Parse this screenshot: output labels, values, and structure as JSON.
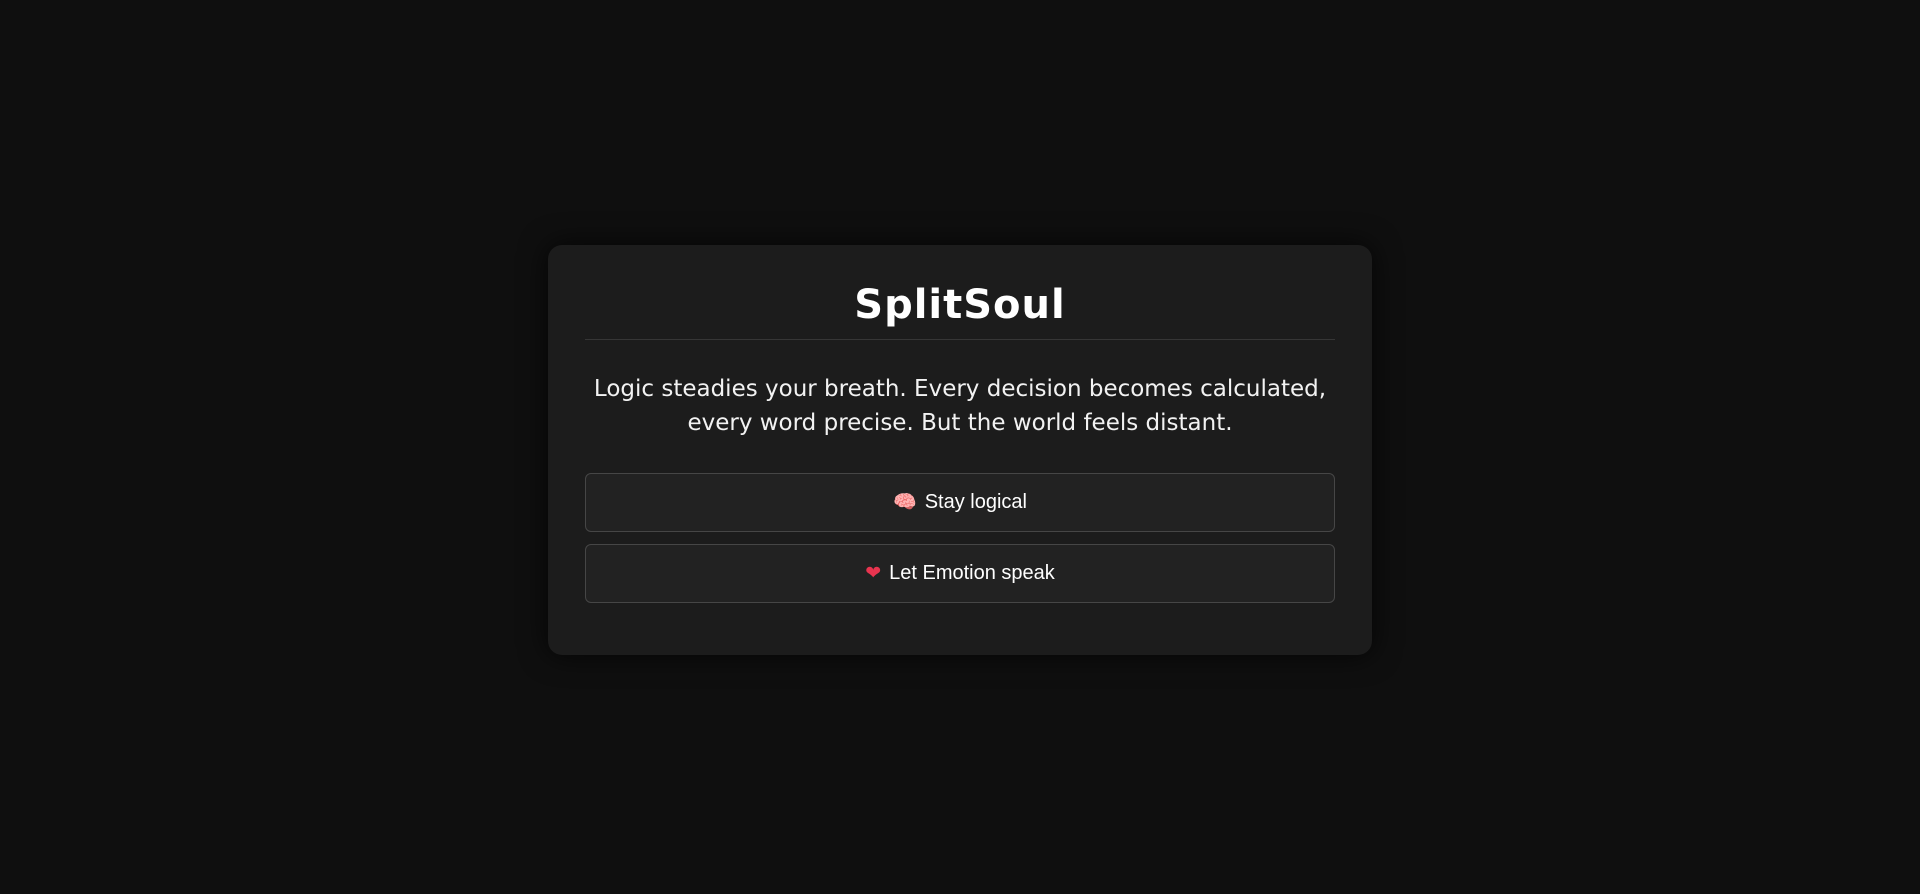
{
  "app": {
    "title": "SplitSoul"
  },
  "scene": {
    "text": "Logic steadies your breath. Every decision becomes calculated, every word precise. But the world feels distant."
  },
  "choices": [
    {
      "icon": "brain-icon",
      "glyph": "🧠",
      "label": "Stay logical",
      "color": "#e88fd0"
    },
    {
      "icon": "heart-icon",
      "glyph": "❤",
      "label": "Let Emotion speak",
      "color": "#e8344f"
    }
  ],
  "theme": {
    "background": "#0f0f0f",
    "card": "#1c1c1c",
    "button": "#222222",
    "border": "#464646",
    "text": "#ffffff"
  }
}
